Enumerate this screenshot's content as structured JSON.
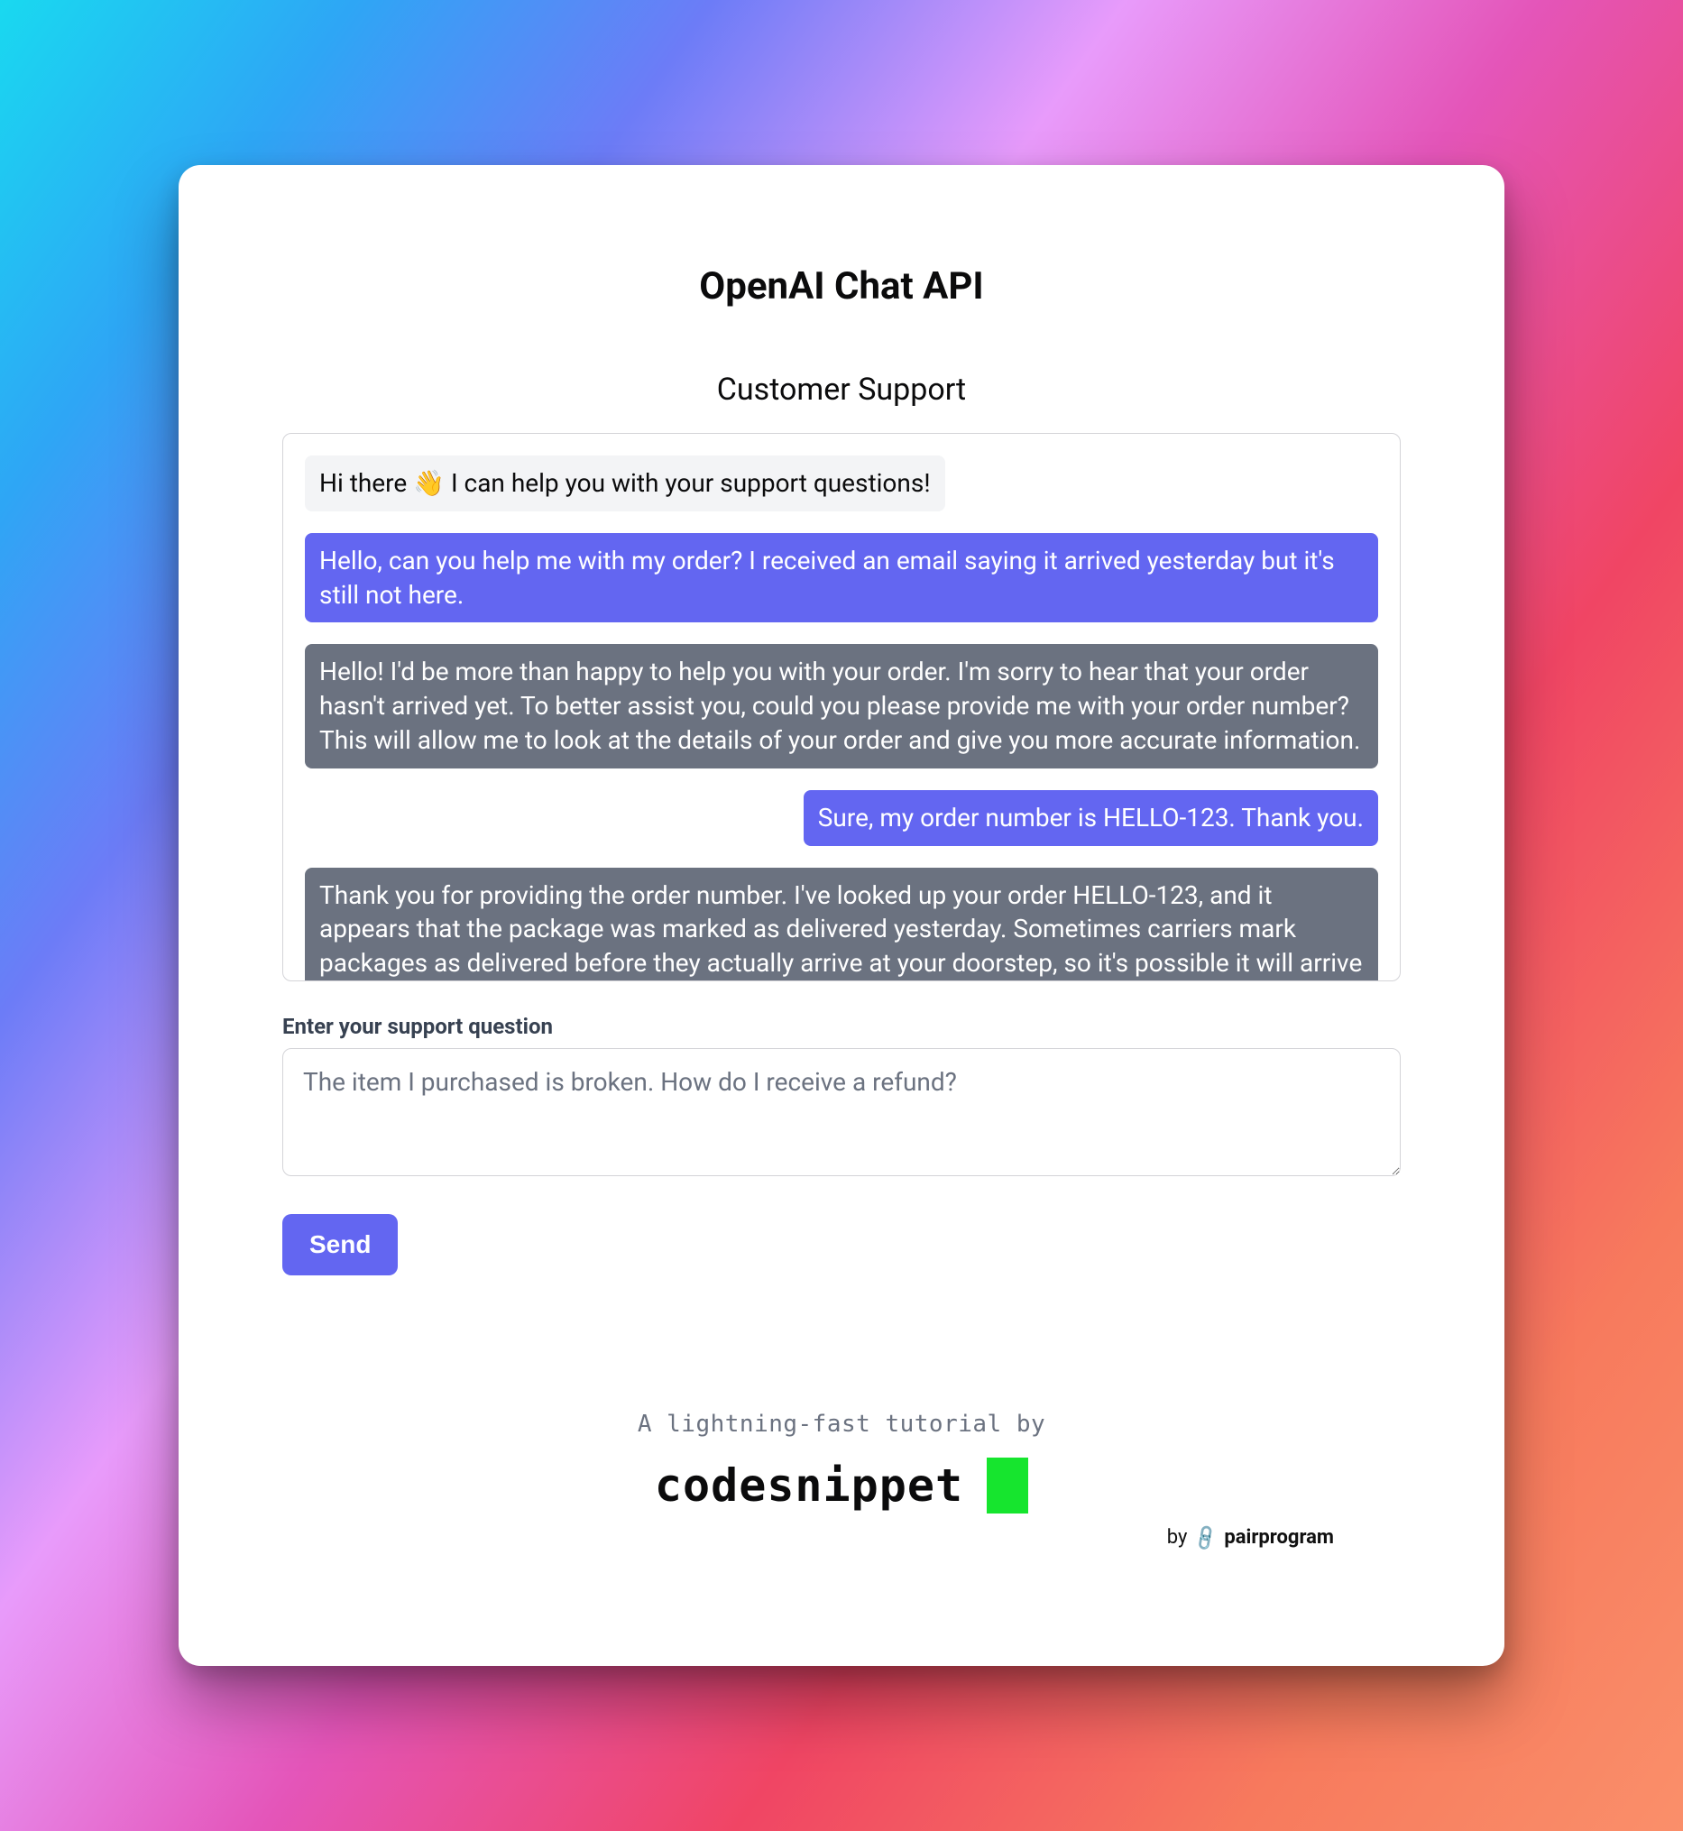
{
  "title": "OpenAI Chat API",
  "subtitle": "Customer Support",
  "messages": [
    {
      "role": "system",
      "text": "Hi there 👋 I can help you with your support questions!"
    },
    {
      "role": "user",
      "text": "Hello, can you help me with my order? I received an email saying it arrived yesterday but it's still not here."
    },
    {
      "role": "assistant",
      "text": "Hello! I'd be more than happy to help you with your order. I'm sorry to hear that your order hasn't arrived yet. To better assist you, could you please provide me with your order number? This will allow me to look at the details of your order and give you more accurate information."
    },
    {
      "role": "user",
      "text": "Sure, my order number is HELLO-123. Thank you."
    },
    {
      "role": "assistant",
      "text": "Thank you for providing the order number. I've looked up your order HELLO-123, and it appears that the package was marked as delivered yesterday. Sometimes carriers mark packages as delivered before they actually arrive at your doorstep, so it's possible it will arrive later today or"
    }
  ],
  "input": {
    "label": "Enter your support question",
    "placeholder": "The item I purchased is broken. How do I receive a refund?",
    "value": ""
  },
  "send_label": "Send",
  "footer": {
    "tagline": "A lightning-fast tutorial by",
    "brand": "codesnippet",
    "by": "by",
    "pairprogram": "pairprogram"
  },
  "colors": {
    "accent": "#6366f1",
    "assistant_bg": "#6b7280",
    "system_bg": "#f3f4f6",
    "brand_green": "#16e52e"
  }
}
